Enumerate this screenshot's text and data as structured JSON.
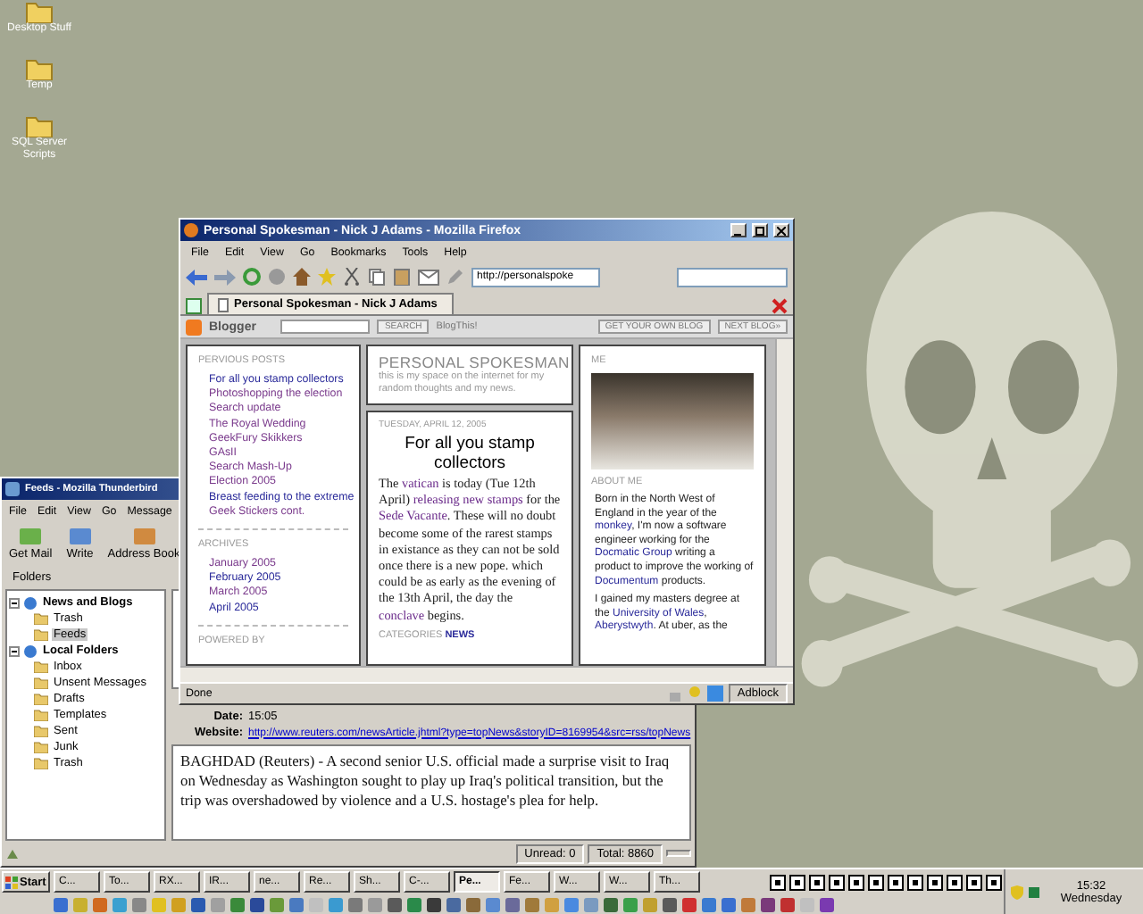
{
  "desktop_icons": [
    {
      "label": "Desktop Stuff"
    },
    {
      "label": "Temp"
    },
    {
      "label": "SQL Server Scripts"
    }
  ],
  "thunderbird": {
    "title": "Feeds - Mozilla Thunderbird",
    "menu": [
      "File",
      "Edit",
      "View",
      "Go",
      "Message"
    ],
    "toolbar": [
      "Get Mail",
      "Write",
      "Address Book"
    ],
    "folders_label": "Folders",
    "folders": [
      {
        "label": "News and Blogs",
        "expanded": true,
        "selected": false,
        "children": [
          {
            "label": "Trash",
            "selected": false
          },
          {
            "label": "Feeds",
            "selected": true
          }
        ]
      },
      {
        "label": "Local Folders",
        "expanded": true,
        "selected": false,
        "children": [
          {
            "label": "Inbox",
            "selected": false
          },
          {
            "label": "Unsent Messages",
            "selected": false
          },
          {
            "label": "Drafts",
            "selected": false
          },
          {
            "label": "Templates",
            "selected": false
          },
          {
            "label": "Sent",
            "selected": false
          },
          {
            "label": "Junk",
            "selected": false
          },
          {
            "label": "Trash",
            "selected": false
          }
        ]
      }
    ],
    "message": {
      "fields": [
        {
          "label": "Date:",
          "value": "15:05",
          "kind": "text"
        },
        {
          "label": "Website:",
          "value": "http://www.reuters.com/newsArticle.jhtml?type=topNews&storyID=8169954&src=rss/topNews",
          "kind": "link"
        }
      ],
      "body": "BAGHDAD (Reuters) - A second senior U.S. official made a surprise visit to Iraq on Wednesday as Washington sought to play up Iraq's political transition, but the trip was overshadowed by violence and a U.S. hostage's plea for help."
    },
    "status": [
      "Unread: 0",
      "Total: 8860"
    ]
  },
  "firefox": {
    "title": "Personal Spokesman - Nick J Adams - Mozilla Firefox",
    "menu": [
      "File",
      "Edit",
      "View",
      "Go",
      "Bookmarks",
      "Tools",
      "Help"
    ],
    "url": "http://personalspoke",
    "tabs": [
      {
        "label": "Personal Spokesman - Nick J Adams",
        "selected": true
      }
    ],
    "blogger_bar": {
      "logo": "Blogger",
      "search_button": "SEARCH",
      "blog_this": "BlogThis!",
      "get_blog": "GET YOUR OWN BLOG",
      "next_blog": "NEXT BLOG»"
    },
    "page": {
      "left": [
        {
          "heading": "PERVIOUS POSTS",
          "links": [
            {
              "text": "For all you stamp collectors",
              "visited": false
            },
            {
              "text": "Photoshopping the election",
              "visited": true
            },
            {
              "text": "Search update",
              "visited": true
            },
            {
              "text": "The Royal Wedding",
              "visited": true
            },
            {
              "text": "GeekFury Skikkers",
              "visited": true
            },
            {
              "text": "GAsII",
              "visited": true
            },
            {
              "text": "Search Mash-Up",
              "visited": true
            },
            {
              "text": "Election 2005",
              "visited": true
            },
            {
              "text": "Breast feeding to the extreme",
              "visited": false
            },
            {
              "text": "Geek Stickers cont.",
              "visited": true
            }
          ]
        },
        {
          "heading": "ARCHIVES",
          "links": [
            {
              "text": "January 2005",
              "visited": true
            },
            {
              "text": "February 2005",
              "visited": false
            },
            {
              "text": "March 2005",
              "visited": true
            },
            {
              "text": "April 2005",
              "visited": false
            }
          ]
        },
        {
          "heading": "POWERED BY"
        }
      ],
      "header": {
        "title": "PERSONAL SPOKESMAN",
        "tagline": "this is my space on the internet for my random thoughts and my news."
      },
      "post": {
        "date": "TUESDAY, APRIL 12, 2005",
        "title": "For all you stamp collectors",
        "paragraphs": [
          [
            {
              "text": "The ",
              "kind": "text"
            },
            {
              "text": "vatican",
              "kind": "link"
            },
            {
              "text": " is today (Tue 12th April) ",
              "kind": "text"
            },
            {
              "text": "releasing new stamps",
              "kind": "link"
            },
            {
              "text": " for the ",
              "kind": "text"
            },
            {
              "text": "Sede Vacante",
              "kind": "link"
            },
            {
              "text": ". These will no doubt become some of the rarest stamps in existance as they can not be sold once there is a new pope. which could be as early as the evening of the 13th April, the day the ",
              "kind": "text"
            },
            {
              "text": "conclave",
              "kind": "link"
            },
            {
              "text": " begins.",
              "kind": "text"
            }
          ]
        ],
        "categories_label": "CATEGORIES",
        "category": "NEWS"
      },
      "about": {
        "me_heading": "ME",
        "about_heading": "ABOUT ME",
        "paragraphs": [
          [
            {
              "text": "Born in the North West of England in the year of the ",
              "kind": "text"
            },
            {
              "text": "monkey",
              "kind": "link"
            },
            {
              "text": ", I'm now a software engineer working for the ",
              "kind": "text"
            },
            {
              "text": "Docmatic Group",
              "kind": "link"
            },
            {
              "text": " writing a product to improve the working of ",
              "kind": "text"
            },
            {
              "text": "Documentum",
              "kind": "link"
            },
            {
              "text": " products.",
              "kind": "text"
            }
          ],
          [
            {
              "text": "I gained my masters degree at the ",
              "kind": "text"
            },
            {
              "text": "University of Wales",
              "kind": "link"
            },
            {
              "text": ", ",
              "kind": "text"
            },
            {
              "text": "Aberystwyth",
              "kind": "link"
            },
            {
              "text": ". At uber, as the",
              "kind": "text"
            }
          ]
        ]
      }
    },
    "status": "Done",
    "adblock": "Adblock"
  },
  "taskbar": {
    "start": "Start",
    "buttons": [
      {
        "label": "C...",
        "selected": false
      },
      {
        "label": "To...",
        "selected": false
      },
      {
        "label": "RX...",
        "selected": false
      },
      {
        "label": "IR...",
        "selected": false
      },
      {
        "label": "ne...",
        "selected": false
      },
      {
        "label": "Re...",
        "selected": false
      },
      {
        "label": "Sh...",
        "selected": false
      },
      {
        "label": "C-...",
        "selected": false
      },
      {
        "label": "Pe...",
        "selected": true
      },
      {
        "label": "Fe...",
        "selected": false
      },
      {
        "label": "W...",
        "selected": false
      },
      {
        "label": "W...",
        "selected": false
      },
      {
        "label": "Th...",
        "selected": false
      }
    ],
    "time": "15:32",
    "day": "Wednesday"
  }
}
